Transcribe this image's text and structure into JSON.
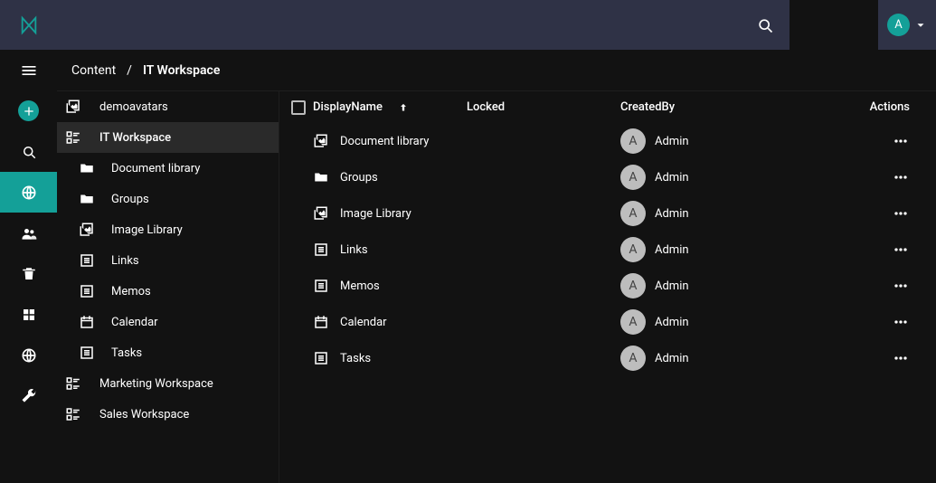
{
  "colors": {
    "accent": "#14a098"
  },
  "topbar": {
    "avatar_initial": "A"
  },
  "breadcrumb": {
    "root": "Content",
    "separator": "/",
    "current": "IT Workspace"
  },
  "tree": [
    {
      "label": "demoavatars",
      "depth": 0,
      "icon": "image-collection",
      "active": false
    },
    {
      "label": "IT Workspace",
      "depth": 0,
      "icon": "workspace",
      "active": true
    },
    {
      "label": "Document library",
      "depth": 1,
      "icon": "folder",
      "active": false
    },
    {
      "label": "Groups",
      "depth": 1,
      "icon": "folder",
      "active": false
    },
    {
      "label": "Image Library",
      "depth": 1,
      "icon": "image-collection",
      "active": false
    },
    {
      "label": "Links",
      "depth": 1,
      "icon": "list",
      "active": false
    },
    {
      "label": "Memos",
      "depth": 1,
      "icon": "list",
      "active": false
    },
    {
      "label": "Calendar",
      "depth": 1,
      "icon": "calendar",
      "active": false
    },
    {
      "label": "Tasks",
      "depth": 1,
      "icon": "list",
      "active": false
    },
    {
      "label": "Marketing Workspace",
      "depth": 0,
      "icon": "workspace",
      "active": false
    },
    {
      "label": "Sales Workspace",
      "depth": 0,
      "icon": "workspace",
      "active": false
    }
  ],
  "grid": {
    "columns": {
      "display_name": "DisplayName",
      "locked": "Locked",
      "created_by": "CreatedBy",
      "actions": "Actions"
    },
    "sort": {
      "column": "display_name",
      "direction": "asc"
    },
    "rows": [
      {
        "icon": "image-collection",
        "display_name": "Document library",
        "locked": "",
        "created_by": "Admin",
        "avatar": "A"
      },
      {
        "icon": "folder",
        "display_name": "Groups",
        "locked": "",
        "created_by": "Admin",
        "avatar": "A"
      },
      {
        "icon": "image-collection",
        "display_name": "Image Library",
        "locked": "",
        "created_by": "Admin",
        "avatar": "A"
      },
      {
        "icon": "list",
        "display_name": "Links",
        "locked": "",
        "created_by": "Admin",
        "avatar": "A"
      },
      {
        "icon": "list",
        "display_name": "Memos",
        "locked": "",
        "created_by": "Admin",
        "avatar": "A"
      },
      {
        "icon": "calendar",
        "display_name": "Calendar",
        "locked": "",
        "created_by": "Admin",
        "avatar": "A"
      },
      {
        "icon": "list",
        "display_name": "Tasks",
        "locked": "",
        "created_by": "Admin",
        "avatar": "A"
      }
    ]
  }
}
